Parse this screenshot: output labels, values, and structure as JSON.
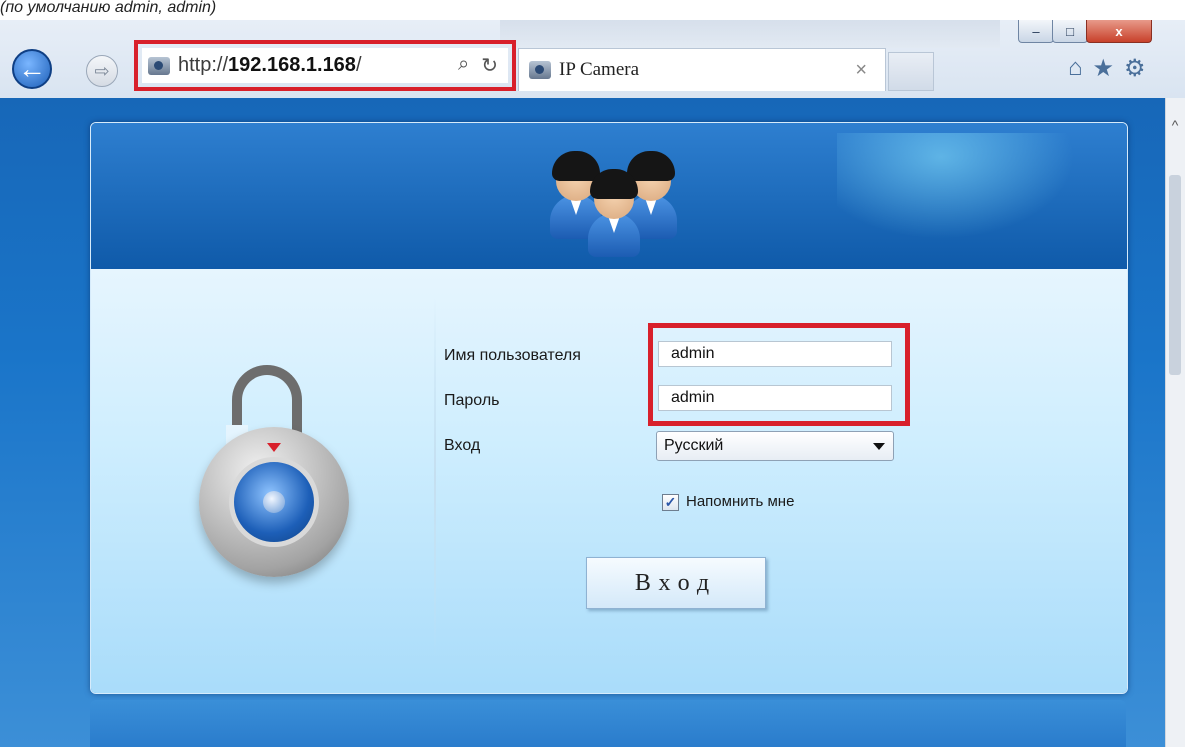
{
  "caption": "(по умолчанию admin, admin)",
  "browser": {
    "back_icon": "←",
    "forward_icon": "⇨",
    "url_scheme": "http://",
    "url_host": "192.168.1.168",
    "url_path": "/",
    "search_icon": "⌕",
    "refresh_icon": "↻",
    "tab_title": "IP Camera",
    "tab_close": "×",
    "home_icon": "⌂",
    "favorites_icon": "★",
    "tools_icon": "⚙",
    "win_min": "–",
    "win_max": "□",
    "win_close": "x"
  },
  "login": {
    "username_label": "Имя пользователя",
    "username_value": "admin",
    "password_label": "Пароль",
    "password_value": "admin",
    "language_label": "Вход",
    "language_value": "Русский",
    "remember_label": "Напомнить мне",
    "remember_checked": true,
    "checkbox_mark": "✓",
    "submit_label": "Вход"
  },
  "colors": {
    "highlight": "#d8202b",
    "header_blue": "#0f5aa9",
    "body_blue": "#a9dcfa"
  }
}
